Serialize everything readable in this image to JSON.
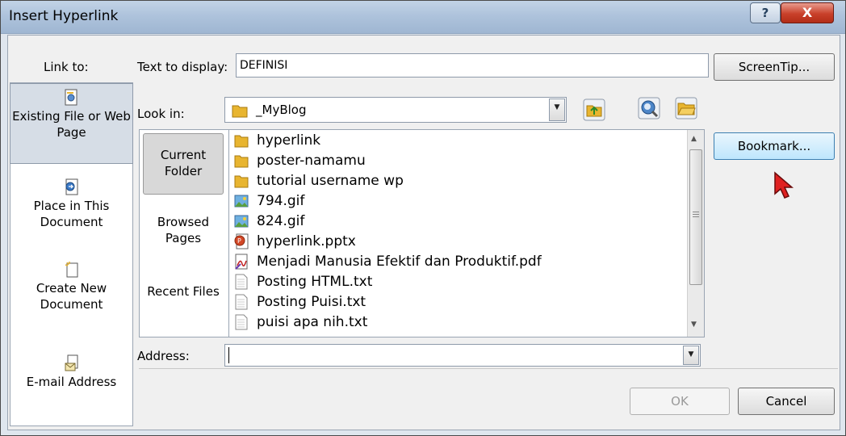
{
  "window": {
    "title": "Insert Hyperlink",
    "help_label": "?",
    "close_label": "X"
  },
  "link_to": {
    "heading": "Link to:",
    "items": [
      {
        "label": "Existing File or Web Page",
        "icon": "existing-file-icon"
      },
      {
        "label": "Place in This Document",
        "icon": "place-in-document-icon"
      },
      {
        "label": "Create New Document",
        "icon": "create-new-document-icon"
      },
      {
        "label": "E-mail Address",
        "icon": "email-address-icon"
      }
    ]
  },
  "text_to_display": {
    "label": "Text to display:",
    "value": "DEFINISI"
  },
  "screentip_label": "ScreenTip...",
  "look_in": {
    "label": "Look in:",
    "value": "_MyBlog"
  },
  "nav": {
    "items": [
      "Current Folder",
      "Browsed Pages",
      "Recent Files"
    ]
  },
  "files": [
    {
      "name": "hyperlink",
      "icon": "folder-icon"
    },
    {
      "name": "poster-namamu",
      "icon": "folder-icon"
    },
    {
      "name": "tutorial username wp",
      "icon": "folder-icon"
    },
    {
      "name": "794.gif",
      "icon": "image-icon"
    },
    {
      "name": "824.gif",
      "icon": "image-icon"
    },
    {
      "name": "hyperlink.pptx",
      "icon": "powerpoint-icon"
    },
    {
      "name": "Menjadi Manusia Efektif dan Produktif.pdf",
      "icon": "pdf-icon"
    },
    {
      "name": "Posting HTML.txt",
      "icon": "text-file-icon"
    },
    {
      "name": "Posting Puisi.txt",
      "icon": "text-file-icon"
    },
    {
      "name": "puisi apa nih.txt",
      "icon": "text-file-icon"
    }
  ],
  "bookmark_label": "Bookmark...",
  "address": {
    "label": "Address:",
    "value": ""
  },
  "buttons": {
    "ok": "OK",
    "cancel": "Cancel"
  },
  "colors": {
    "accent": "#3c7fb1",
    "folder": "#e8b530",
    "close_red": "#c9402a",
    "cursor": "#e02020"
  }
}
